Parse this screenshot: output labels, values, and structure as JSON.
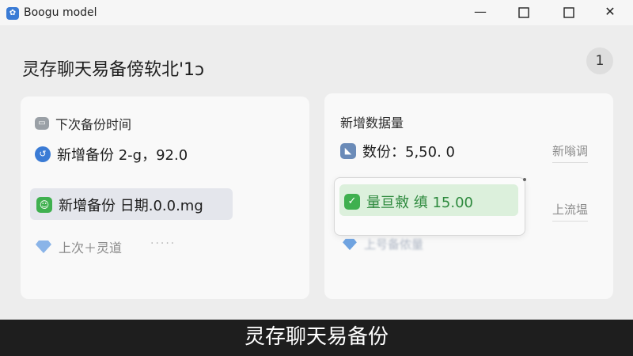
{
  "window": {
    "title": "Boogu model",
    "minimize": "—",
    "maximize": "☐",
    "close": "✕"
  },
  "header": {
    "title": "灵存聊天易备傍软北'1ɔ",
    "badge": "1"
  },
  "left_card": {
    "title": "下次备份时间",
    "row1": "新增备份 2-g，92.0",
    "row2": "新增备份 日期.0.0.mg",
    "row3": "上次＋灵道",
    "dots": "·····"
  },
  "right_card": {
    "title": "新增数据量",
    "row1": "数份：5,50. 0",
    "btn1": "新嗡调",
    "btn2": "上流塭",
    "popup_text": "量亘敹 缜 15.00",
    "blur_text": "上号备侬量"
  },
  "caption": "灵存聊天易备份",
  "colors": {
    "blue": "#3a7bd5",
    "green": "#3fb04f",
    "popup_green": "#dcf0dc"
  }
}
